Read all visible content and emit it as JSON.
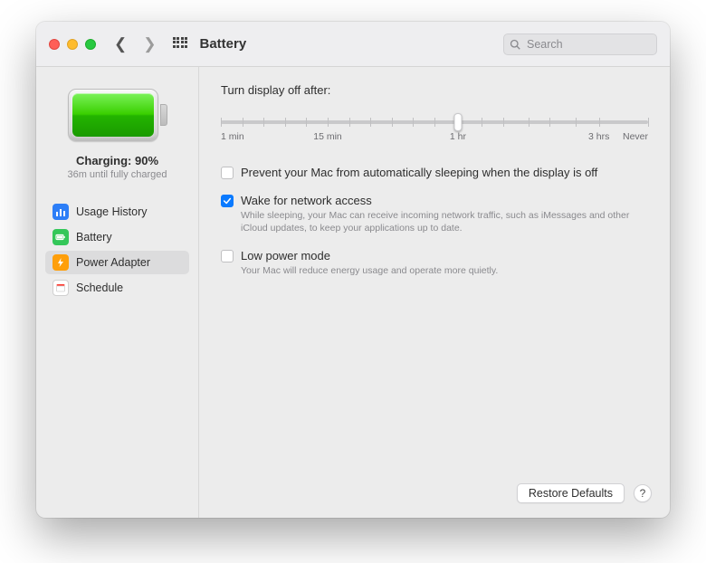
{
  "window": {
    "title": "Battery"
  },
  "search": {
    "placeholder": "Search"
  },
  "sidebar": {
    "charge_label": "Charging: 90%",
    "charge_sub": "36m until fully charged",
    "items": [
      {
        "label": "Usage History",
        "icon": "usage-history-icon",
        "color": "#2c7ef7"
      },
      {
        "label": "Battery",
        "icon": "battery-icon",
        "color": "#34c759"
      },
      {
        "label": "Power Adapter",
        "icon": "power-adapter-icon",
        "color": "#ff9f0a"
      },
      {
        "label": "Schedule",
        "icon": "schedule-icon",
        "color": "#ffffff"
      }
    ],
    "selected_index": 2
  },
  "main": {
    "slider_label": "Turn display off after:",
    "slider": {
      "ticks": [
        "1 min",
        "15 min",
        "1 hr",
        "3 hrs",
        "Never"
      ],
      "value_position_pct": 55.5
    },
    "options": [
      {
        "checked": false,
        "label": "Prevent your Mac from automatically sleeping when the display is off",
        "desc": null
      },
      {
        "checked": true,
        "label": "Wake for network access",
        "desc": "While sleeping, your Mac can receive incoming network traffic, such as iMessages and other iCloud updates, to keep your applications up to date."
      },
      {
        "checked": false,
        "label": "Low power mode",
        "desc": "Your Mac will reduce energy usage and operate more quietly."
      }
    ],
    "restore_button": "Restore Defaults",
    "help_button": "?"
  }
}
